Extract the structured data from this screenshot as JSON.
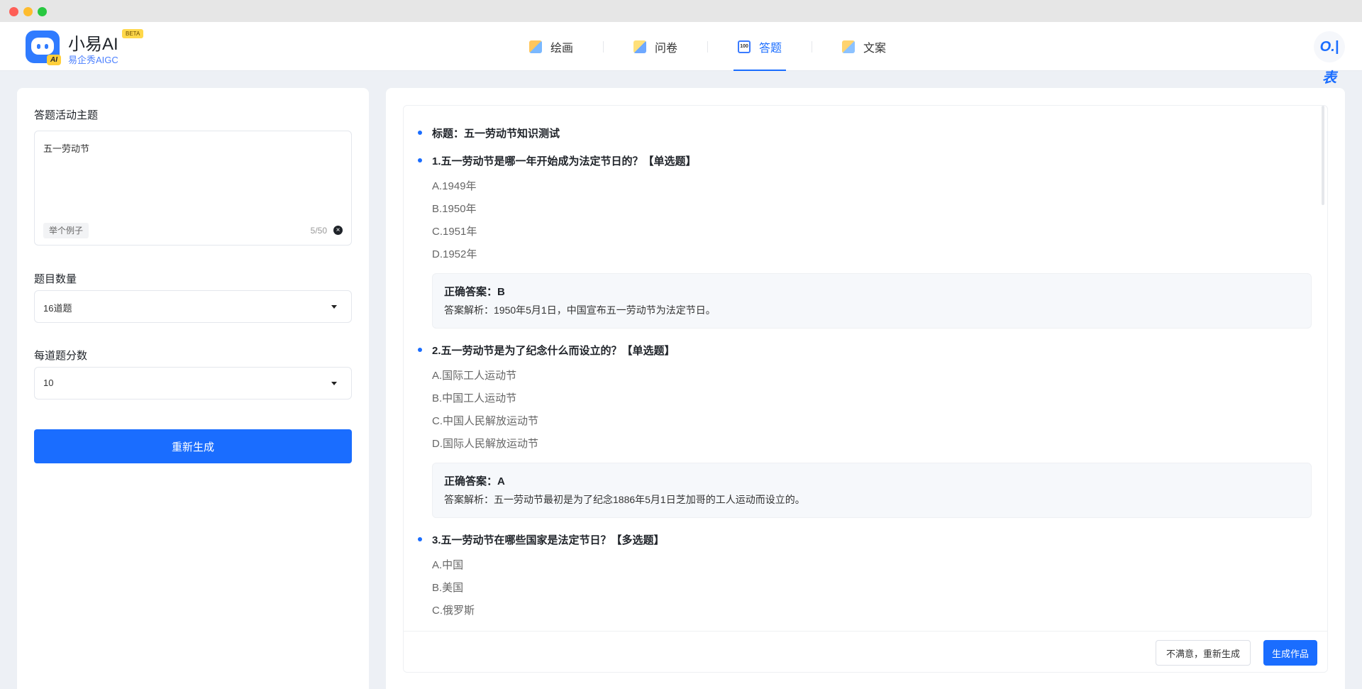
{
  "brand": {
    "name": "小易AI",
    "badge": "BETA",
    "subtitle": "易企秀AIGC",
    "logo_badge": "AI",
    "corner_logo": "O.|表"
  },
  "nav": [
    {
      "label": "绘画",
      "icon": "paint-icon"
    },
    {
      "label": "问卷",
      "icon": "questionnaire-icon"
    },
    {
      "label": "答题",
      "icon": "quiz-icon",
      "icon_text": "100"
    },
    {
      "label": "文案",
      "icon": "copywriting-icon"
    }
  ],
  "accent": "#1a6dff",
  "form": {
    "topic_label": "答题活动主题",
    "topic_value": "五一劳动节",
    "example_label": "举个例子",
    "counter": "5/50",
    "count_label": "题目数量",
    "count_value": "16道题",
    "score_label": "每道题分数",
    "score_value": "10",
    "regen_label": "重新生成"
  },
  "quiz": {
    "title": "标题：五一劳动节知识测试",
    "questions": [
      {
        "q": "1.五一劳动节是哪一年开始成为法定节日的？【单选题】",
        "options": [
          "A.1949年",
          "B.1950年",
          "C.1951年",
          "D.1952年"
        ],
        "answer": "正确答案：B",
        "explain": "答案解析：1950年5月1日，中国宣布五一劳动节为法定节日。"
      },
      {
        "q": "2.五一劳动节是为了纪念什么而设立的？【单选题】",
        "options": [
          "A.国际工人运动节",
          "B.中国工人运动节",
          "C.中国人民解放运动节",
          "D.国际人民解放运动节"
        ],
        "answer": "正确答案：A",
        "explain": "答案解析：五一劳动节最初是为了纪念1886年5月1日芝加哥的工人运动而设立的。"
      },
      {
        "q": "3.五一劳动节在哪些国家是法定节日？【多选题】",
        "options": [
          "A.中国",
          "B.美国",
          "C.俄罗斯"
        ]
      }
    ]
  },
  "footer": {
    "unsatisfied_label": "不满意，重新生成",
    "make_label": "生成作品"
  }
}
